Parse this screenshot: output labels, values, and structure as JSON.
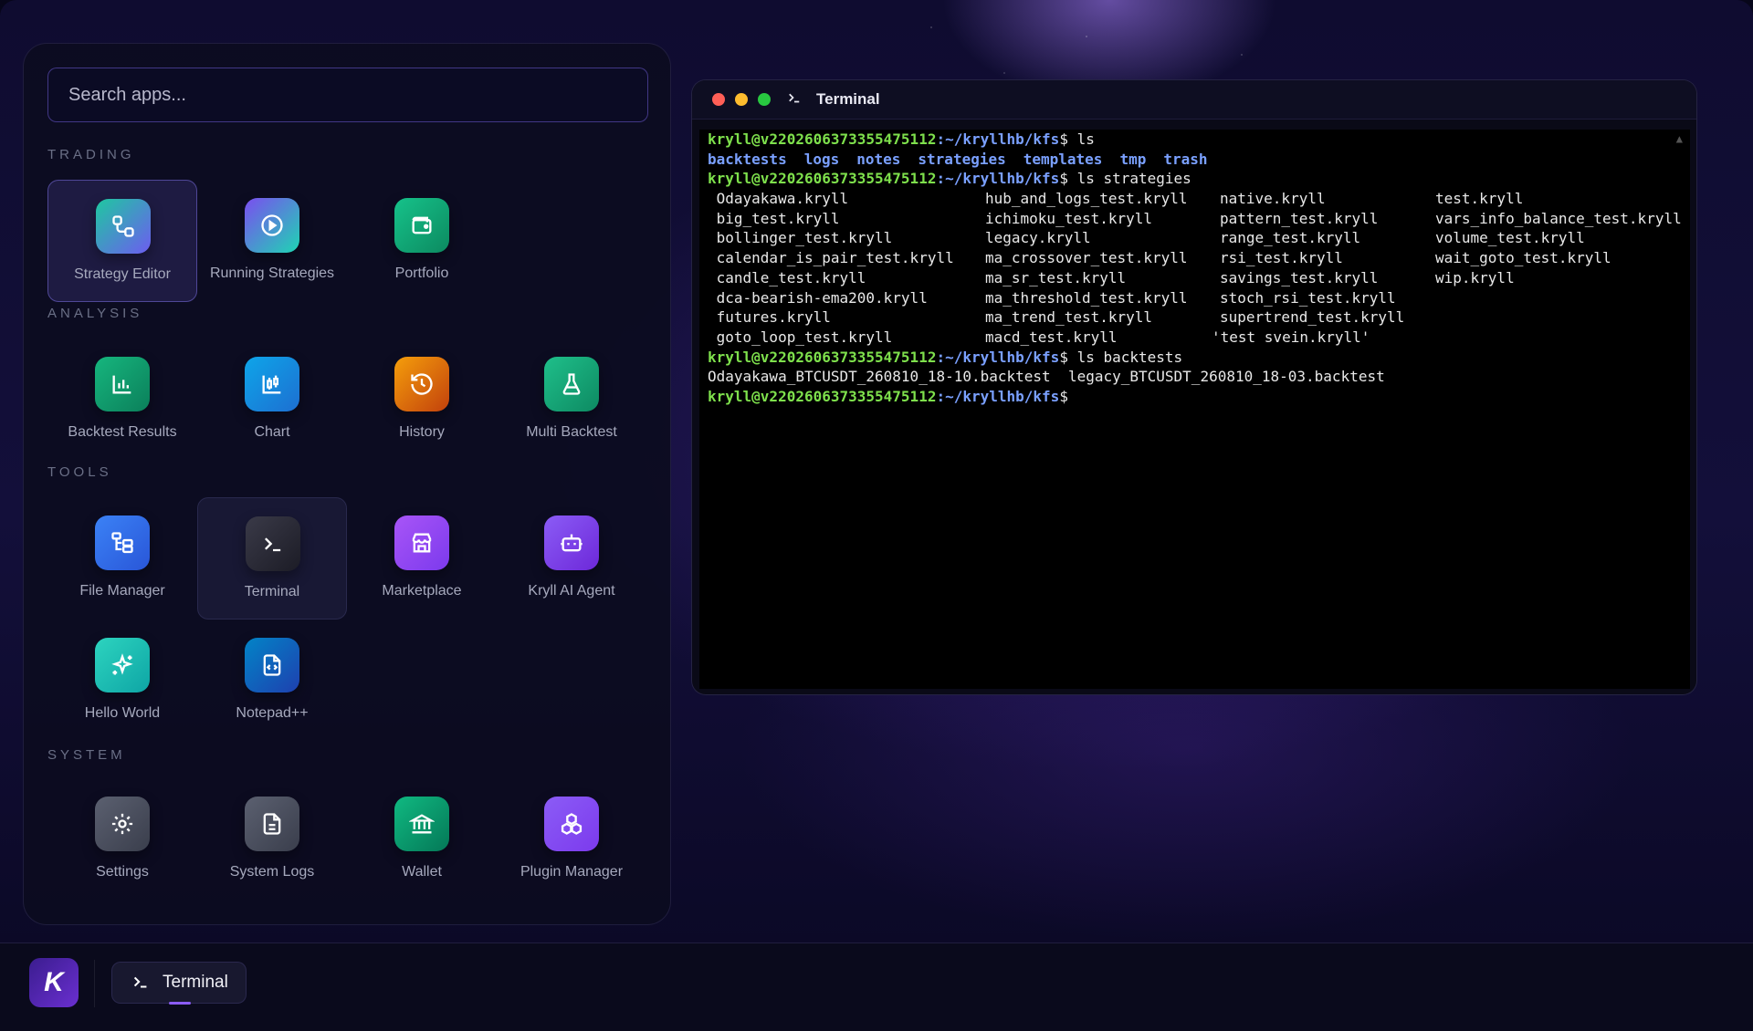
{
  "launcher": {
    "search_placeholder": "Search apps...",
    "sections": {
      "trading": "TRADING",
      "analysis": "ANALYSIS",
      "tools": "TOOLS",
      "system": "SYSTEM"
    },
    "apps": {
      "strategy_editor": "Strategy Editor",
      "running_strategies": "Running Strategies",
      "portfolio": "Portfolio",
      "backtest_results": "Backtest Results",
      "chart": "Chart",
      "history": "History",
      "multi_backtest": "Multi Backtest",
      "file_manager": "File Manager",
      "terminal": "Terminal",
      "marketplace": "Marketplace",
      "kryll_ai_agent": "Kryll AI Agent",
      "hello_world": "Hello World",
      "notepad": "Notepad++",
      "settings": "Settings",
      "system_logs": "System Logs",
      "wallet": "Wallet",
      "plugin_manager": "Plugin Manager"
    }
  },
  "terminal": {
    "title": "Terminal",
    "prompt_user": "kryll@v2202606373355475112",
    "prompt_path": ":~/kryllhb/kfs",
    "cmd1": "$ ls",
    "dirs": [
      "backtests",
      "logs",
      "notes",
      "strategies",
      "templates",
      "tmp",
      "trash"
    ],
    "cmd2": "$ ls strategies",
    "strategy_cols": [
      [
        " Odayakawa.kryll",
        " big_test.kryll",
        " bollinger_test.kryll",
        " calendar_is_pair_test.kryll",
        " candle_test.kryll",
        " dca-bearish-ema200.kryll",
        " futures.kryll",
        " goto_loop_test.kryll"
      ],
      [
        "hub_and_logs_test.kryll",
        "ichimoku_test.kryll",
        "legacy.kryll",
        "ma_crossover_test.kryll",
        "ma_sr_test.kryll",
        "ma_threshold_test.kryll",
        "ma_trend_test.kryll",
        "macd_test.kryll"
      ],
      [
        "native.kryll",
        "pattern_test.kryll",
        "range_test.kryll",
        "rsi_test.kryll",
        "savings_test.kryll",
        "stoch_rsi_test.kryll",
        "supertrend_test.kryll",
        "'test svein.kryll'"
      ],
      [
        "test.kryll",
        "vars_info_balance_test.kryll",
        "volume_test.kryll",
        "wait_goto_test.kryll",
        "wip.kryll"
      ]
    ],
    "cmd3": "$ ls backtests",
    "backtests_line": "Odayakawa_BTCUSDT_260810_18-10.backtest  legacy_BTCUSDT_260810_18-03.backtest",
    "cmd4": "$"
  },
  "taskbar": {
    "logo": "K",
    "active_task": "Terminal"
  },
  "colors": {
    "accent": "#8b5cf6",
    "prompt_user": "#7ee04c",
    "prompt_path": "#7aa0ff"
  }
}
